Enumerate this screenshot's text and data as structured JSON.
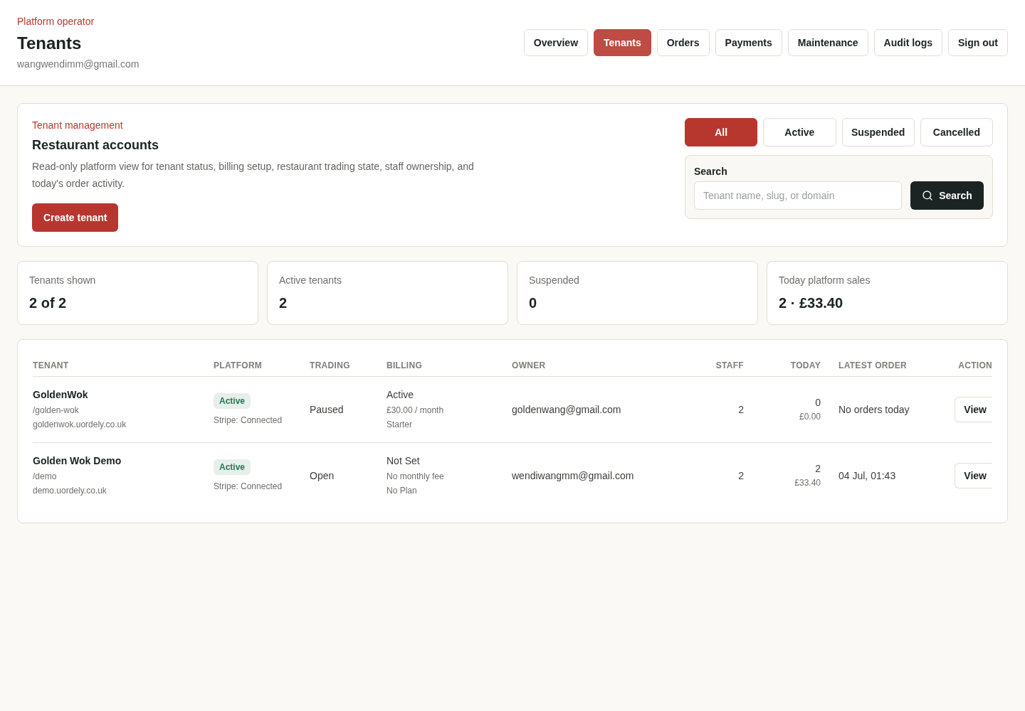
{
  "header": {
    "eyebrow": "Platform operator",
    "title": "Tenants",
    "email": "wangwendimm@gmail.com"
  },
  "nav": [
    {
      "label": "Overview",
      "selected": false
    },
    {
      "label": "Tenants",
      "selected": true
    },
    {
      "label": "Orders",
      "selected": false
    },
    {
      "label": "Payments",
      "selected": false
    },
    {
      "label": "Maintenance",
      "selected": false
    },
    {
      "label": "Audit logs",
      "selected": false
    },
    {
      "label": "Sign out",
      "selected": false
    }
  ],
  "management": {
    "eyebrow": "Tenant management",
    "title": "Restaurant accounts",
    "description": "Read-only platform view for tenant status, billing setup, restaurant trading state, staff ownership, and today's order activity.",
    "create_button": "Create tenant",
    "filters": [
      {
        "label": "All",
        "selected": true
      },
      {
        "label": "Active",
        "selected": false
      },
      {
        "label": "Suspended",
        "selected": false
      },
      {
        "label": "Cancelled",
        "selected": false
      }
    ],
    "search": {
      "label": "Search",
      "placeholder": "Tenant name, slug, or domain",
      "button": "Search"
    }
  },
  "stats": [
    {
      "label": "Tenants shown",
      "value": "2 of 2"
    },
    {
      "label": "Active tenants",
      "value": "2"
    },
    {
      "label": "Suspended",
      "value": "0"
    },
    {
      "label": "Today platform sales",
      "value": "2 · £33.40"
    }
  ],
  "table": {
    "columns": [
      "TENANT",
      "PLATFORM",
      "TRADING",
      "BILLING",
      "OWNER",
      "STAFF",
      "TODAY",
      "LATEST ORDER",
      "ACTION"
    ],
    "rows": [
      {
        "tenant": {
          "name": "GoldenWok",
          "slug": "/golden-wok",
          "domain": "goldenwok.uordely.co.uk"
        },
        "platform": {
          "status": "Active",
          "kind": "active",
          "stripe": "Stripe: Connected"
        },
        "trading": "Paused",
        "billing": {
          "status": "Active",
          "fee": "£30.00 / month",
          "plan": "Starter"
        },
        "owner": "goldenwang@gmail.com",
        "staff": "2",
        "today": {
          "orders": "0",
          "sales": "£0.00"
        },
        "latest_order": "No orders today",
        "action": "View"
      },
      {
        "tenant": {
          "name": "Golden Wok Demo",
          "slug": "/demo",
          "domain": "demo.uordely.co.uk"
        },
        "platform": {
          "status": "Active",
          "kind": "active",
          "stripe": "Stripe: Connected"
        },
        "trading": "Open",
        "billing": {
          "status": "Not Set",
          "fee": "No monthly fee",
          "plan": "No Plan"
        },
        "owner": "wendiwangmm@gmail.com",
        "staff": "2",
        "today": {
          "orders": "2",
          "sales": "£33.40"
        },
        "latest_order": "04 Jul, 01:43",
        "action": "View"
      }
    ]
  }
}
